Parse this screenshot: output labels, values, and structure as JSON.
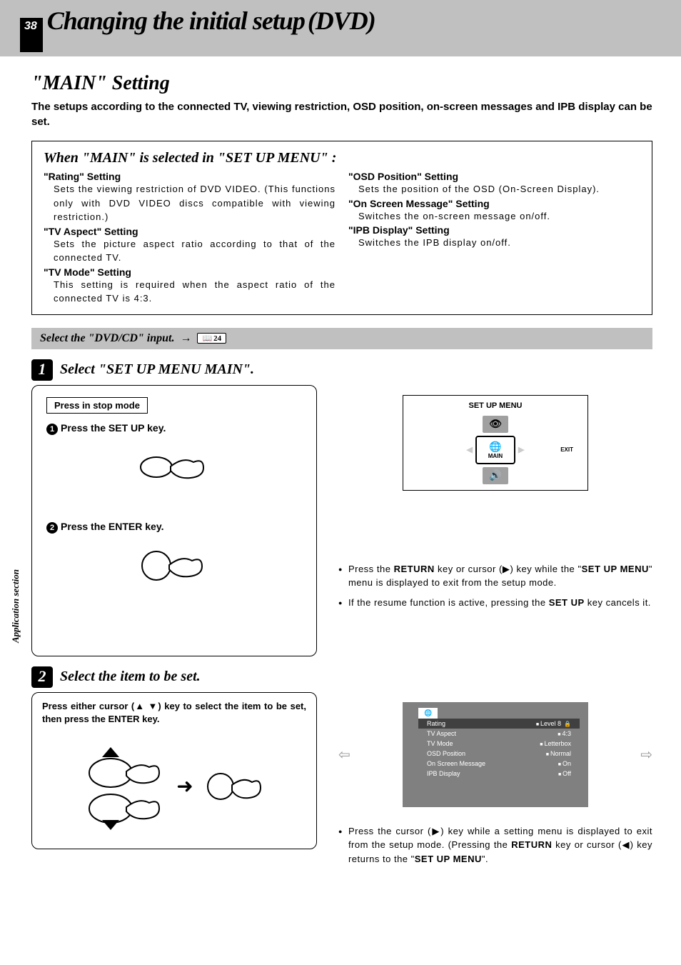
{
  "page_number": "38",
  "header": {
    "title_main": "Changing the initial setup",
    "title_sub": "(DVD)"
  },
  "section_title": "\"MAIN\" Setting",
  "intro": "The setups according to the connected TV, viewing restriction, OSD position, on-screen messages and IPB display can be set.",
  "frame": {
    "title": "When \"MAIN\" is selected in \"SET UP MENU\" :",
    "left": [
      {
        "head": "\"Rating\" Setting",
        "desc": "Sets the viewing restriction of DVD VIDEO. (This functions only with DVD VIDEO discs compatible with viewing restriction.)"
      },
      {
        "head": "\"TV Aspect\" Setting",
        "desc": "Sets the picture aspect ratio according to that of the connected TV."
      },
      {
        "head": "\"TV Mode\" Setting",
        "desc": "This setting is required when the aspect ratio of the connected TV is 4:3."
      }
    ],
    "right": [
      {
        "head": "\"OSD Position\" Setting",
        "desc": "Sets the position of the OSD (On-Screen Display)."
      },
      {
        "head": "\"On Screen Message\" Setting",
        "desc": "Switches the on-screen message on/off."
      },
      {
        "head": "\"IPB Display\" Setting",
        "desc": "Switches the IPB display on/off."
      }
    ]
  },
  "gray_bar": {
    "text": "Select the \"DVD/CD\" input.",
    "ref": "24"
  },
  "step1": {
    "num": "1",
    "label": "Select \"SET UP MENU MAIN\".",
    "press_box": "Press in stop mode",
    "sub1": "Press the SET UP key.",
    "sub2": "Press the ENTER key."
  },
  "setup_menu": {
    "title": "SET UP MENU",
    "center": "MAIN",
    "exit": "EXIT"
  },
  "notes1": [
    "Press the RETURN key or cursor (▶) key while the \"SET UP MENU\" menu is displayed to exit from the setup mode.",
    "If the resume function is active, pressing the SET UP key cancels it."
  ],
  "step2": {
    "num": "2",
    "label": "Select the item to be set.",
    "instr": "Press either cursor (▲ ▼) key to select the item to be set, then press the ENTER key."
  },
  "settings_screen": {
    "rows": [
      {
        "k": "Rating",
        "v": "Level 8",
        "lock": true,
        "hl": true
      },
      {
        "k": "TV Aspect",
        "v": "4:3"
      },
      {
        "k": "TV Mode",
        "v": "Letterbox"
      },
      {
        "k": "OSD Position",
        "v": "Normal"
      },
      {
        "k": "On Screen Message",
        "v": "On"
      },
      {
        "k": "IPB Display",
        "v": "Off"
      }
    ]
  },
  "notes2": [
    "Press the cursor (▶) key while a setting menu is displayed to exit from the setup mode. (Pressing the RETURN key or cursor (◀) key returns to the \"SET UP MENU\"."
  ],
  "sidebar_text": "Application section"
}
